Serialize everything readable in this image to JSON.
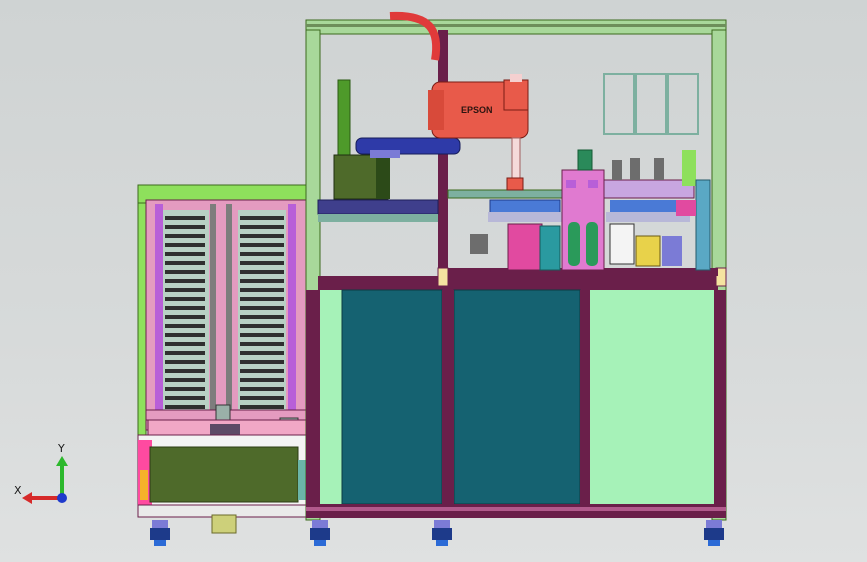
{
  "robot": {
    "brand_label": "EPSON",
    "body_color": "#e85a4a",
    "arm_color": "#2e3aa8"
  },
  "triad": {
    "x_label": "X",
    "y_label": "Y"
  },
  "colors": {
    "frame": "#6a1f4a",
    "panel_green": "#a6f2b8",
    "panel_teal": "#156271",
    "rack_pink": "#e49bc0",
    "base_olive": "#4e6a2a"
  }
}
